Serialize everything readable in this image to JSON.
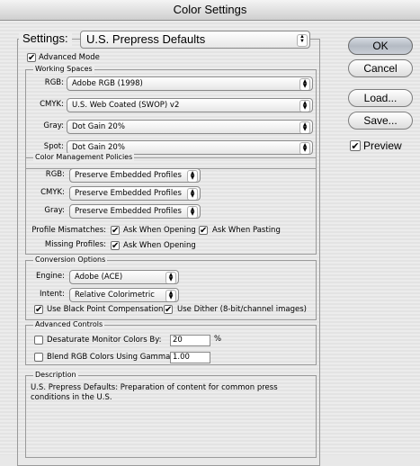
{
  "window": {
    "title": "Color Settings"
  },
  "settings": {
    "label": "Settings:",
    "value": "U.S. Prepress Defaults"
  },
  "advanced_mode": {
    "label": "Advanced Mode",
    "checked": true
  },
  "working_spaces": {
    "title": "Working Spaces",
    "rows": [
      {
        "label": "RGB:",
        "value": "Adobe RGB (1998)"
      },
      {
        "label": "CMYK:",
        "value": "U.S. Web Coated (SWOP) v2"
      },
      {
        "label": "Gray:",
        "value": "Dot Gain 20%"
      },
      {
        "label": "Spot:",
        "value": "Dot Gain 20%"
      }
    ]
  },
  "policies": {
    "title": "Color Management Policies",
    "rows": [
      {
        "label": "RGB:",
        "value": "Preserve Embedded Profiles"
      },
      {
        "label": "CMYK:",
        "value": "Preserve Embedded Profiles"
      },
      {
        "label": "Gray:",
        "value": "Preserve Embedded Profiles"
      }
    ],
    "mismatch_label": "Profile Mismatches:",
    "ask_opening": "Ask When Opening",
    "ask_pasting": "Ask When Pasting",
    "missing_label": "Missing Profiles:",
    "missing_ask_opening": "Ask When Opening"
  },
  "conversion": {
    "title": "Conversion Options",
    "engine_label": "Engine:",
    "engine_value": "Adobe (ACE)",
    "intent_label": "Intent:",
    "intent_value": "Relative Colorimetric",
    "black_point": "Use Black Point Compensation",
    "dither": "Use Dither (8-bit/channel images)"
  },
  "advanced": {
    "title": "Advanced Controls",
    "desaturate_label": "Desaturate Monitor Colors By:",
    "desaturate_value": "20",
    "desaturate_unit": "%",
    "blend_label": "Blend RGB Colors Using Gamma:",
    "blend_value": "1.00"
  },
  "description": {
    "title": "Description",
    "text": "U.S. Prepress Defaults:  Preparation of content for common press conditions in the U.S."
  },
  "buttons": {
    "ok": "OK",
    "cancel": "Cancel",
    "load": "Load...",
    "save": "Save..."
  },
  "preview": {
    "label": "Preview",
    "checked": true
  },
  "icons": {
    "checkmark": "✔",
    "popup_arrows": "▲▼"
  }
}
